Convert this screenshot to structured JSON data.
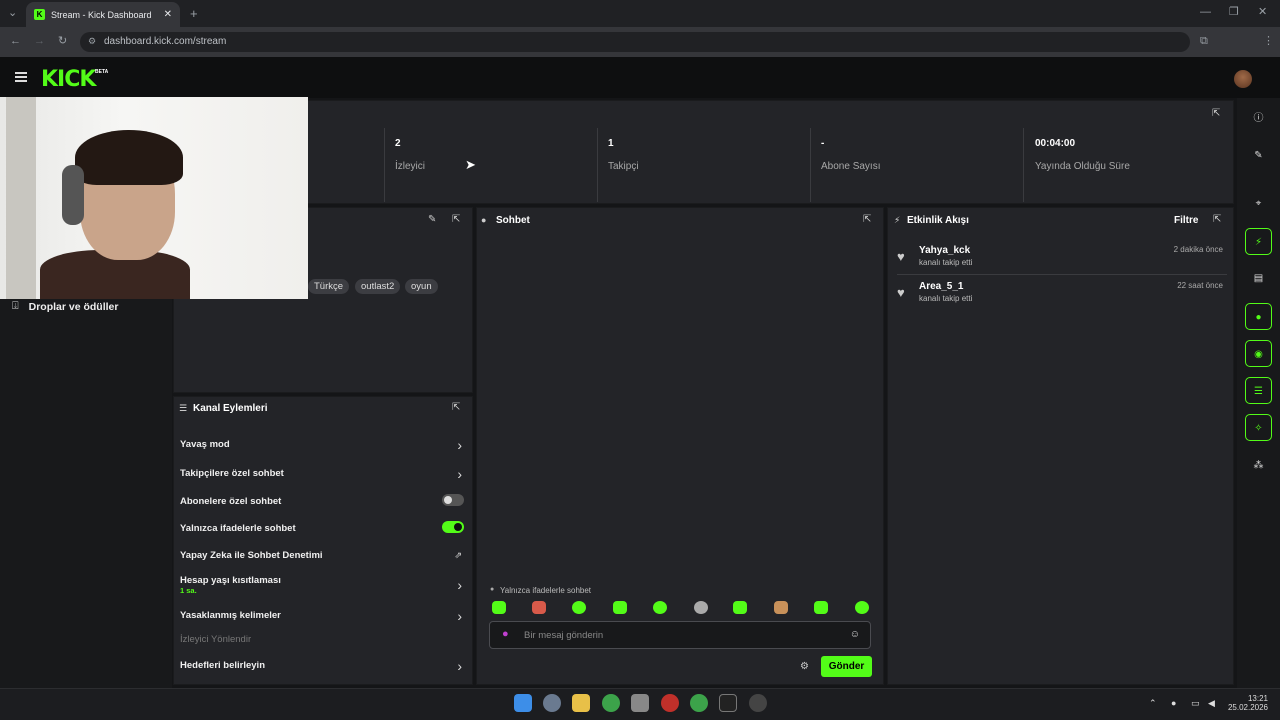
{
  "browser": {
    "tab_title": "Stream - Kick Dashboard",
    "url": "dashboard.kick.com/stream"
  },
  "header": {
    "logo": "KICK",
    "beta": "BETA"
  },
  "stats": [
    {
      "value": "2",
      "label": "İzleyici"
    },
    {
      "value": "1",
      "label": "Takipçi"
    },
    {
      "value": "-",
      "label": "Abone Sayısı"
    },
    {
      "value": "00:04:00",
      "label": "Yayında Olduğu Süre"
    }
  ],
  "info": {
    "tags": [
      "Türkçe",
      "outlast2",
      "oyun"
    ]
  },
  "sidebar": {
    "drops_label": "Droplar ve ödüller"
  },
  "chat": {
    "title": "Sohbet",
    "mode_notice": "Yalnızca ifadelerle sohbet",
    "placeholder": "Bir mesaj gönderin",
    "send_label": "Gönder"
  },
  "feed": {
    "title": "Etkinlik Akışı",
    "filter_label": "Filtre",
    "items": [
      {
        "name": "Yahya_kck",
        "action": "kanalı takip etti",
        "time": "2 dakika önce"
      },
      {
        "name": "Area_5_1",
        "action": "kanalı takip etti",
        "time": "22 saat önce"
      }
    ]
  },
  "actions": {
    "title": "Kanal Eylemleri",
    "slow_mode": "Yavaş mod",
    "followers_only": "Takipçilere özel sohbet",
    "subscribers_only": "Abonelere özel sohbet",
    "emotes_only": "Yalnızca ifadelerle sohbet",
    "ai_moderation": "Yapay Zeka ile Sohbet Denetimi",
    "account_age": "Hesap yaşı kısıtlaması",
    "account_age_value": "1 sa.",
    "banned_words": "Yasaklanmış kelimeler",
    "viewer_redirect": "İzleyici Yönlendir",
    "set_goals": "Hedefleri belirleyin",
    "subscribers_only_on": false,
    "emotes_only_on": true
  },
  "taskbar": {
    "time": "13:21",
    "date": "25.02.2026"
  }
}
